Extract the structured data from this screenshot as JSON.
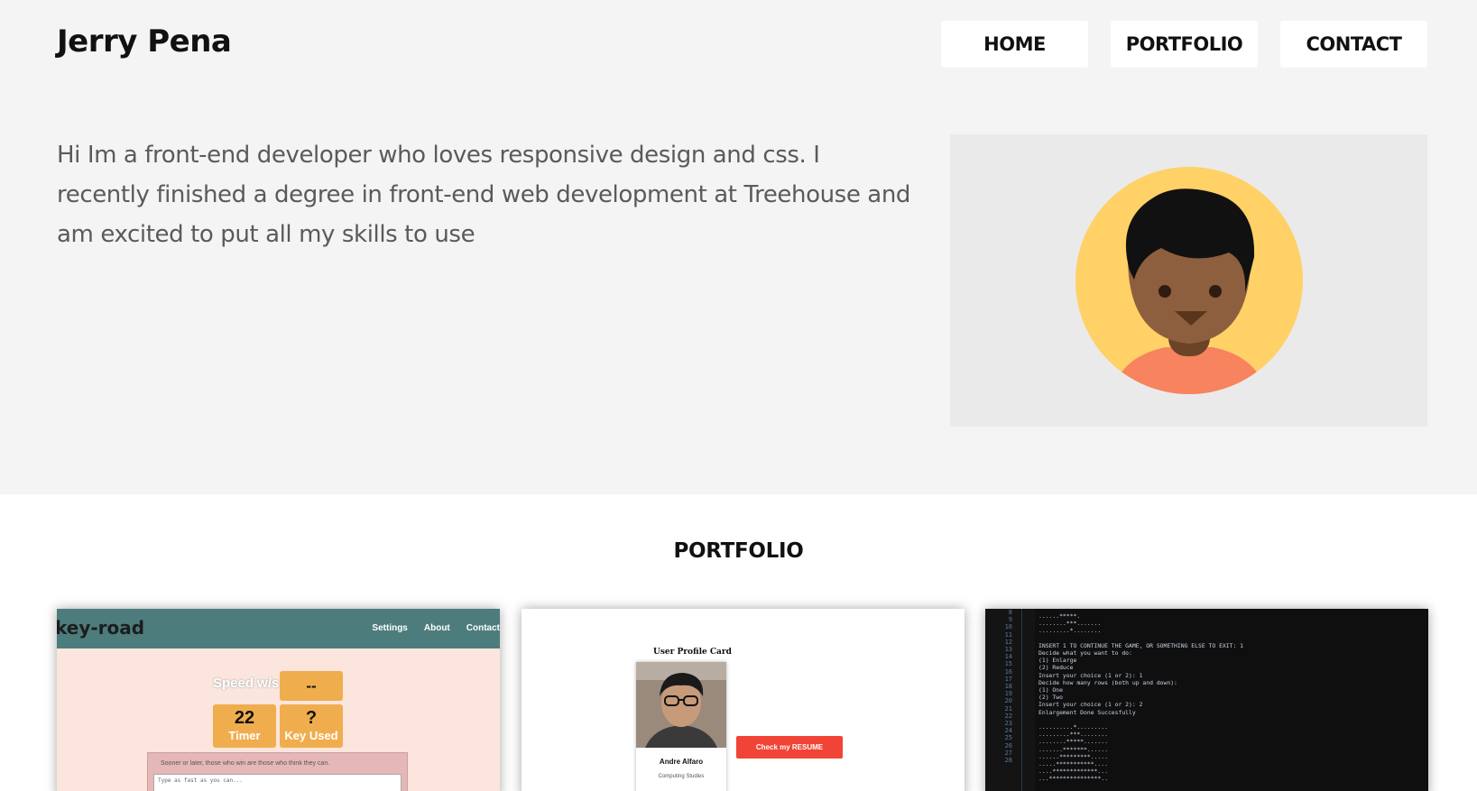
{
  "header": {
    "brand": "Jerry Pena",
    "nav": [
      {
        "label": "HOME"
      },
      {
        "label": "PORTFOLIO"
      },
      {
        "label": "CONTACT"
      }
    ]
  },
  "intro": {
    "text": "Hi Im a front-end developer who loves responsive design and css. I recently finished a degree in front-end web development at Treehouse and am excited to put all my skills to use"
  },
  "colors": {
    "avatar_bg": "#ffd166",
    "skin": "#8d5f3e",
    "shirt": "#f7835f",
    "hair": "#111111"
  },
  "portfolio": {
    "title": "PORTFOLIO",
    "cards": [
      {
        "logo": "key-road",
        "links": [
          "Settings",
          "About",
          "Contact"
        ],
        "speed_label": "Speed w/s",
        "speed_value": "--",
        "timer_value": "22",
        "timer_label": "Timer",
        "key_value": "?",
        "key_label": "Key Used",
        "quote": "Sooner or later, those who win are those who think they can.",
        "input_placeholder": "Type as fast as you can..."
      },
      {
        "title": "User Profile Card",
        "name": "Andre Alfaro",
        "subtitle": "Computing Studies",
        "button": "Check my RESUME"
      },
      {
        "line_numbers": "8\n9\n10\n11\n12\n13\n14\n15\n16\n17\n18\n19\n20\n21\n22\n23\n24\n25\n26\n27\n28",
        "code": "......*****.\n........***.......\n.........*........\n\nINSERT 1 TO CONTINUE THE GAME, OR SOMETHING ELSE TO EXIT: 1\nDecide what you want to do:\n(1) Enlarge\n(2) Reduce\nInsert your choice (1 or 2): 1\nDecide how many rows (both up and down):\n(1) One\n(2) Two\nInsert your choice (1 or 2): 2\nEnlargement Done Succesfully\n\n..........*.........\n.........***........\n........*****.......\n.......*******......\n......*********.....\n.....***********....\n....*************...\n...***************.."
      }
    ]
  }
}
